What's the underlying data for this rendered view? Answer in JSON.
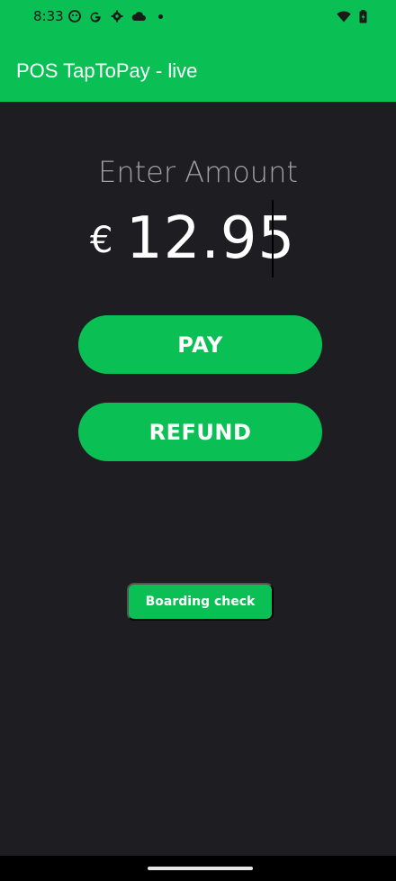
{
  "status_bar": {
    "time": "8:33",
    "icons": [
      "face-icon",
      "google-icon",
      "settings-icon",
      "cloud-icon",
      "dot-icon",
      "wifi-icon",
      "battery-icon"
    ]
  },
  "app_bar": {
    "title": "POS TapToPay - live"
  },
  "amount_entry": {
    "label": "Enter Amount",
    "currency_symbol": "€",
    "value": "12.95"
  },
  "actions": {
    "pay_label": "PAY",
    "refund_label": "REFUND",
    "boarding_check_label": "Boarding check"
  },
  "colors": {
    "accent": "#0abf53",
    "background": "#1e1e22",
    "label": "#a0a0a4"
  }
}
